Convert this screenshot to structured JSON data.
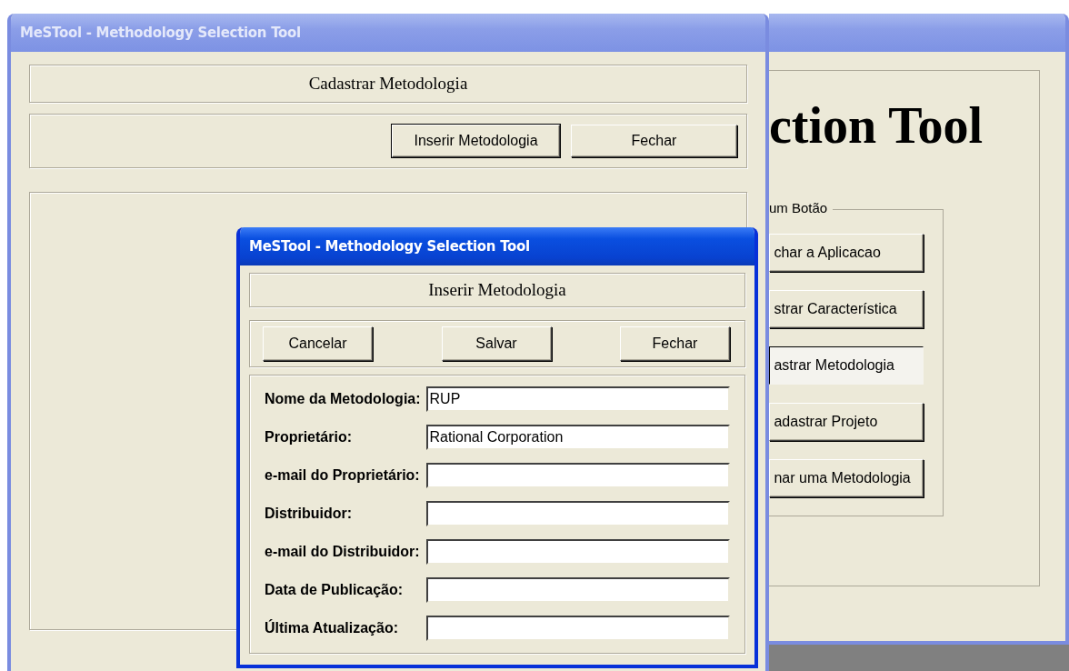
{
  "windows": [
    {
      "kind": "main",
      "active": false,
      "heading": "ction Tool",
      "group_label": "um Botão",
      "buttons": [
        {
          "label": "char a Aplicacao",
          "highlighted": false
        },
        {
          "label": "strar Característica",
          "highlighted": false
        },
        {
          "label": "astrar Metodologia",
          "highlighted": true
        },
        {
          "label": "adastrar Projeto",
          "highlighted": false
        },
        {
          "label": "nar uma Metodologia",
          "highlighted": false
        }
      ]
    },
    {
      "kind": "list",
      "active": false,
      "title": "MeSTool - Methodology Selection Tool",
      "header": "Cadastrar Metodologia",
      "buttons": [
        {
          "label": "Inserir Metodologia",
          "default": true
        },
        {
          "label": "Fechar",
          "default": false
        }
      ]
    },
    {
      "kind": "form",
      "active": true,
      "title": "MeSTool - Methodology Selection Tool",
      "header": "Inserir Metodologia",
      "buttons": [
        {
          "label": "Cancelar"
        },
        {
          "label": "Salvar"
        },
        {
          "label": "Fechar"
        }
      ],
      "fields": [
        {
          "label": "Nome da Metodologia:",
          "value": "RUP"
        },
        {
          "label": "Proprietário:",
          "value": "Rational Corporation"
        },
        {
          "label": "e-mail do Proprietário:"
        },
        {
          "label": "Distribuidor:"
        },
        {
          "label": "e-mail do Distribuidor:"
        },
        {
          "label": "Data de Publicação:"
        },
        {
          "label": "Última Atualização:"
        }
      ]
    }
  ]
}
